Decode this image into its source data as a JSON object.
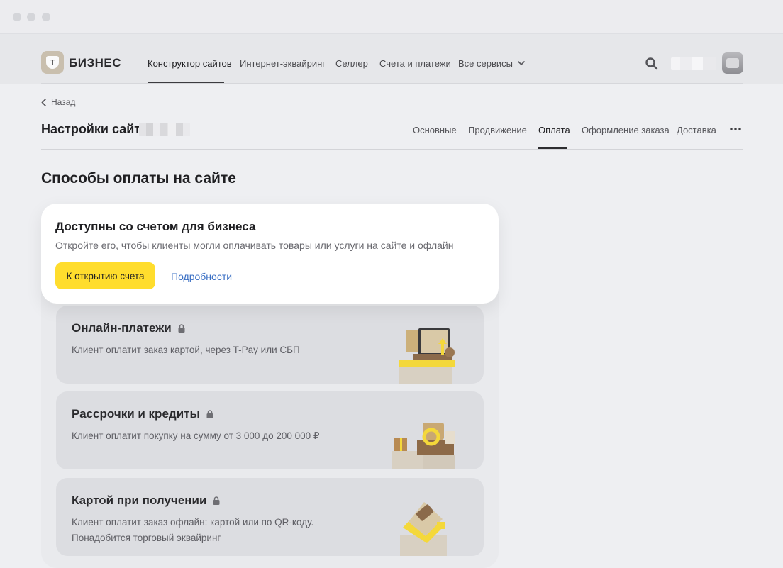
{
  "header": {
    "brand": "БИЗНЕС",
    "logo_letter": "Т",
    "nav": [
      {
        "label": "Конструктор сайтов",
        "active": true
      },
      {
        "label": "Интернет-эквайринг",
        "active": false
      },
      {
        "label": "Селлер",
        "active": false
      },
      {
        "label": "Счета и платежи",
        "active": false
      },
      {
        "label": "Все сервисы",
        "active": false
      }
    ]
  },
  "page": {
    "back_label": "Назад",
    "title": "Настройки сайта",
    "tabs": [
      {
        "label": "Основные",
        "active": false
      },
      {
        "label": "Продвижение",
        "active": false
      },
      {
        "label": "Оплата",
        "active": true
      },
      {
        "label": "Оформление заказа",
        "active": false
      },
      {
        "label": "Доставка",
        "active": false
      }
    ],
    "section_title": "Способы оплаты на сайте"
  },
  "promo": {
    "title": "Доступны со счетом для бизнеса",
    "text": "Откройте его, чтобы клиенты могли оплачивать товары или услуги на сайте и офлайн",
    "button_label": "К открытию счета",
    "link_label": "Подробности"
  },
  "methods": [
    {
      "title": "Онлайн-платежи",
      "lines": [
        "Клиент оплатит заказ картой, через T-Pay или СБП"
      ],
      "icon": "laptop-illustration"
    },
    {
      "title": "Рассрочки и кредиты",
      "lines": [
        "Клиент оплатит покупку на сумму от 3 000 до 200 000 ₽"
      ],
      "icon": "gifts-illustration"
    },
    {
      "title": "Картой при получении",
      "lines": [
        "Клиент оплатит заказ офлайн: картой или по QR-коду.",
        "Понадобится торговый эквайринг"
      ],
      "icon": "terminal-illustration"
    }
  ],
  "colors": {
    "accent": "#ffdd2d",
    "link": "#3a6fc4",
    "page_bg": "#eeeff2"
  }
}
